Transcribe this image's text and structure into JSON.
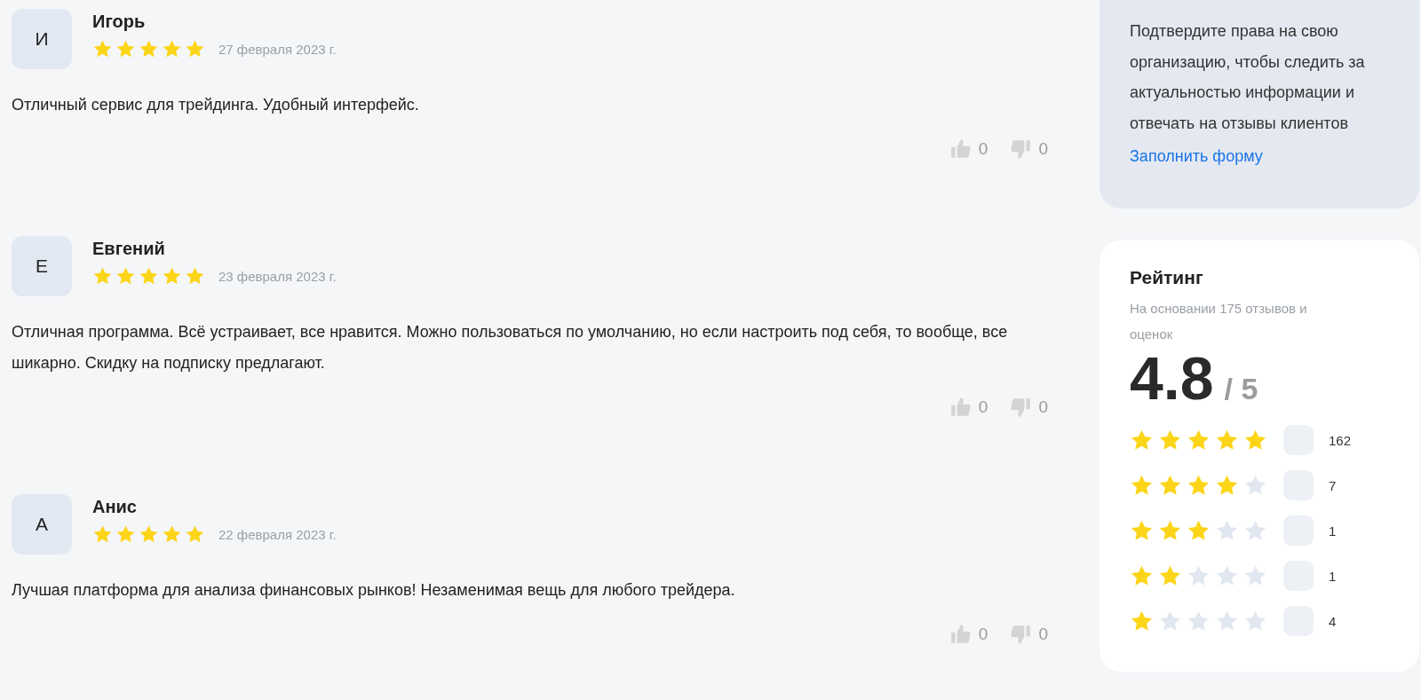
{
  "reviews": [
    {
      "initial": "И",
      "name": "Игорь",
      "stars": 5,
      "date": "27 февраля 2023 г.",
      "text": "Отличный сервис для трейдинга. Удобный интерфейс.",
      "likes": "0",
      "dislikes": "0"
    },
    {
      "initial": "Е",
      "name": "Евгений",
      "stars": 5,
      "date": "23 февраля 2023 г.",
      "text": "Отличная программа. Всё устраивает, все нравится. Можно пользоваться по умолчанию, но если настроить под себя, то вообще, все шикарно. Скидку на подписку предлагают.",
      "likes": "0",
      "dislikes": "0"
    },
    {
      "initial": "А",
      "name": "Анис",
      "stars": 5,
      "date": "22 февраля 2023 г.",
      "text": "Лучшая платформа для анализа финансовых рынков! Незаменимая вещь для любого трейдера.",
      "likes": "0",
      "dislikes": "0"
    }
  ],
  "claim_card": {
    "text": "Подтвердите права на свою организацию, чтобы следить за актуальностью информации и отвечать на отзывы клиентов",
    "link": "Заполнить форму"
  },
  "rating": {
    "title": "Рейтинг",
    "subtitle": "На основании 175 отзывов и оценок",
    "score": "4.8",
    "max": "/ 5",
    "rows": [
      {
        "stars": 5,
        "count": "162"
      },
      {
        "stars": 4,
        "count": "7"
      },
      {
        "stars": 3,
        "count": "1"
      },
      {
        "stars": 2,
        "count": "1"
      },
      {
        "stars": 1,
        "count": "4"
      }
    ]
  }
}
